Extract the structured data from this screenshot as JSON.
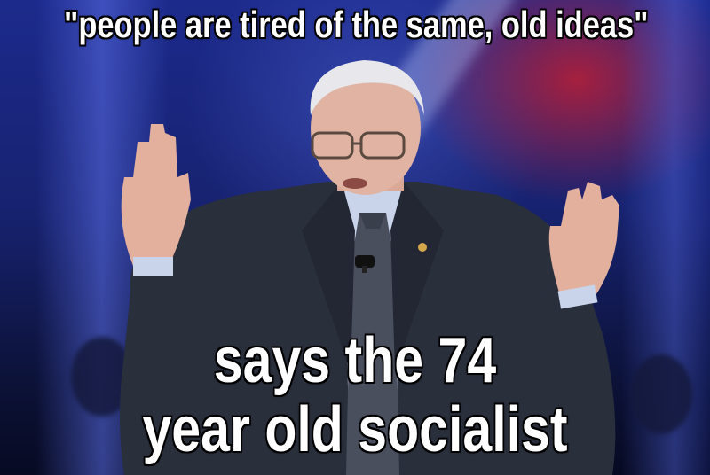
{
  "meme": {
    "top_text": "\"people are tired of the same, old ideas\"",
    "bottom_line_1": "says the 74",
    "bottom_line_2": "year old socialist"
  },
  "colors": {
    "caption_text": "#ffffff",
    "caption_outline": "#000000",
    "backdrop_blue": "#1c2a8c",
    "backdrop_red": "#be1e32",
    "suit": "#2a2f3c",
    "shirt": "#c9d4ea"
  },
  "scene": {
    "subject": "elderly-man-speaking",
    "icons": [
      "hand-raised-left-icon",
      "hand-raised-right-icon",
      "microphone-icon",
      "lapel-pin-icon"
    ]
  }
}
